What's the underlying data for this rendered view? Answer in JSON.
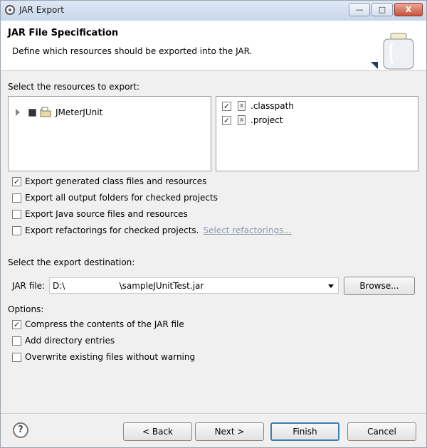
{
  "window": {
    "title": "JAR Export",
    "min_glyph": "—",
    "max_glyph": "□",
    "close_glyph": "X"
  },
  "header": {
    "title": "JAR File Specification",
    "description": "Define which resources should be exported into the JAR.",
    "icon": "jar-icon"
  },
  "resources": {
    "label": "Select the resources to export:",
    "tree": [
      {
        "label": "JMeterJUnit",
        "checked": "partial",
        "icon": "project-icon"
      }
    ],
    "files": [
      {
        "label": ".classpath",
        "checked": true,
        "check_glyph": "✓",
        "icon_glyph": "x"
      },
      {
        "label": ".project",
        "checked": true,
        "check_glyph": "✓",
        "icon_glyph": "x"
      }
    ]
  },
  "options_top": [
    {
      "label": "Export generated class files and resources",
      "checked": true,
      "glyph": "✓"
    },
    {
      "label": "Export all output folders for checked projects",
      "checked": false,
      "glyph": ""
    },
    {
      "label": "Export Java source files and resources",
      "checked": false,
      "glyph": ""
    },
    {
      "label": "Export refactorings for checked projects.",
      "checked": false,
      "glyph": "",
      "link": "Select refactorings..."
    }
  ],
  "destination": {
    "label": "Select the export destination:",
    "jar_label": "JAR file:",
    "jar_value": "D:\\                    \\sampleJUnitTest.jar",
    "browse_label": "Browse..."
  },
  "options": {
    "label": "Options:",
    "items": [
      {
        "label": "Compress the contents of the JAR file",
        "checked": true,
        "glyph": "✓"
      },
      {
        "label": "Add directory entries",
        "checked": false,
        "glyph": ""
      },
      {
        "label": "Overwrite existing files without warning",
        "checked": false,
        "glyph": ""
      }
    ]
  },
  "buttons": {
    "help": "?",
    "back": "< Back",
    "next": "Next >",
    "finish": "Finish",
    "cancel": "Cancel"
  }
}
